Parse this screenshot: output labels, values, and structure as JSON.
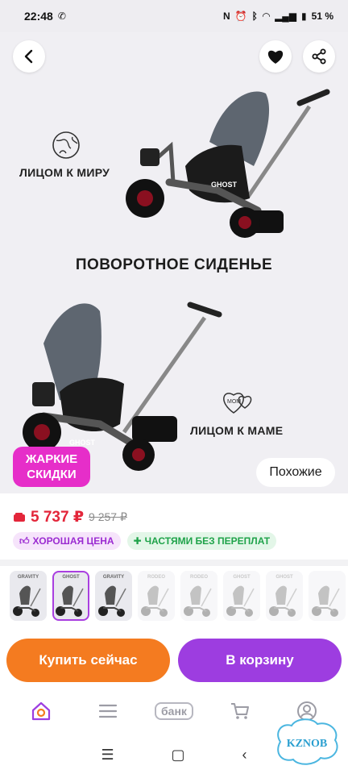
{
  "status_bar": {
    "time": "22:48",
    "battery": "51 %"
  },
  "hero": {
    "label_world": "ЛИЦОМ К МИРУ",
    "label_mom": "ЛИЦОМ К МАМЕ",
    "mom_icon_text": "MOM",
    "title": "ПОВОРОТНОЕ СИДЕНЬЕ",
    "stroller_brand": "GHOST",
    "promo_line1": "ЖАРКИЕ",
    "promo_line2": "СКИДКИ",
    "similar_label": "Похожие"
  },
  "product": {
    "price": "5 737 ₽",
    "old_price": "9 257 ₽",
    "badge_good": "ХОРОШАЯ ЦЕНА",
    "badge_installments": "ЧАСТЯМИ БЕЗ ПЕРЕПЛАТ"
  },
  "thumbnails": [
    {
      "label": "GRAVITY",
      "active": false,
      "faded": false
    },
    {
      "label": "GHOST",
      "active": true,
      "faded": false
    },
    {
      "label": "GRAVITY",
      "active": false,
      "faded": false
    },
    {
      "label": "RODEO",
      "active": false,
      "faded": true
    },
    {
      "label": "RODEO",
      "active": false,
      "faded": true
    },
    {
      "label": "GHOST",
      "active": false,
      "faded": true
    },
    {
      "label": "GHOST",
      "active": false,
      "faded": true
    },
    {
      "label": "",
      "active": false,
      "faded": true
    }
  ],
  "actions": {
    "buy_now": "Купить сейчас",
    "add_to_cart": "В корзину"
  },
  "tabbar": {
    "bank_label": "банк"
  },
  "watermark": "KZNOB",
  "colors": {
    "accent_purple": "#9d3de0",
    "accent_orange": "#f47b20",
    "price_red": "#e3263a",
    "promo_pink": "#e62ec9"
  }
}
